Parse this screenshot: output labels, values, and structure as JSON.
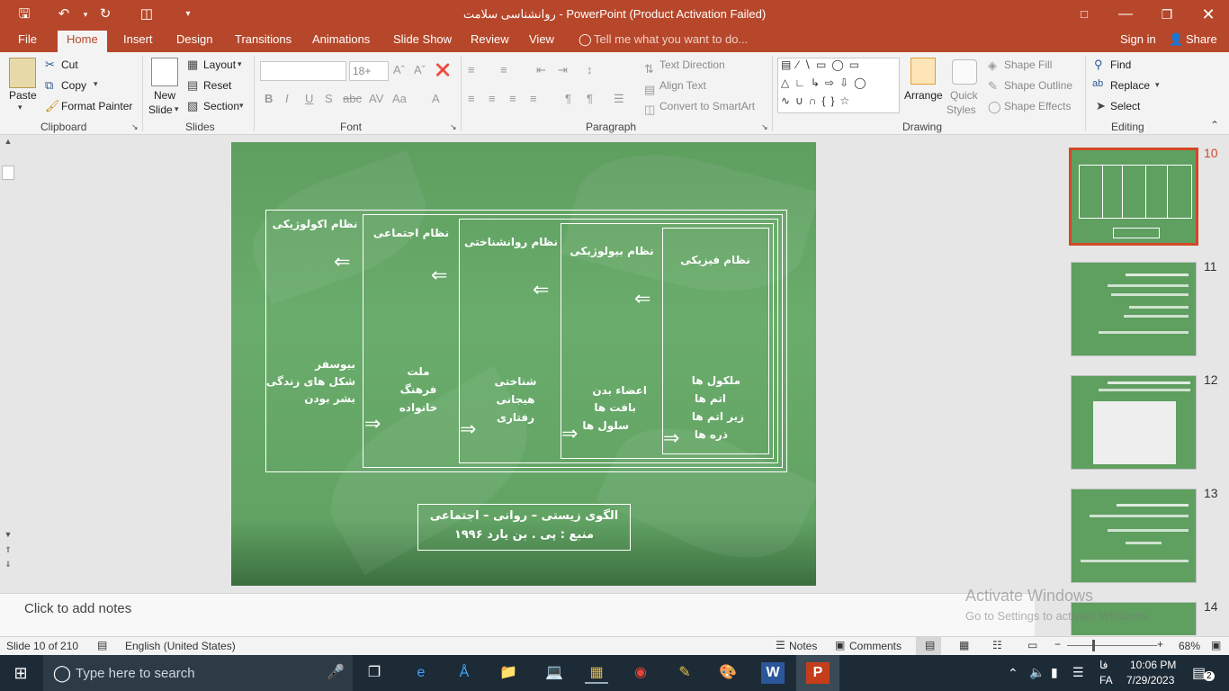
{
  "window": {
    "title": "روانشناسی سلامت - PowerPoint (Product Activation Failed)"
  },
  "tabs": [
    "File",
    "Home",
    "Insert",
    "Design",
    "Transitions",
    "Animations",
    "Slide Show",
    "Review",
    "View"
  ],
  "tell_me": "Tell me what you want to do...",
  "account": {
    "signin": "Sign in",
    "share": "Share"
  },
  "ribbon": {
    "clipboard": {
      "paste": "Paste",
      "cut": "Cut",
      "copy": "Copy",
      "format_painter": "Format Painter",
      "label": "Clipboard"
    },
    "slides": {
      "new_slide_1": "New",
      "new_slide_2": "Slide",
      "layout": "Layout",
      "reset": "Reset",
      "section": "Section",
      "label": "Slides"
    },
    "font": {
      "size": "18+",
      "label": "Font"
    },
    "paragraph": {
      "text_direction": "Text Direction",
      "align_text": "Align Text",
      "convert_smartart": "Convert to SmartArt",
      "label": "Paragraph"
    },
    "drawing": {
      "arrange": "Arrange",
      "quick_1": "Quick",
      "quick_2": "Styles",
      "shape_fill": "Shape Fill",
      "shape_outline": "Shape Outline",
      "shape_effects": "Shape Effects",
      "label": "Drawing"
    },
    "editing": {
      "find": "Find",
      "replace": "Replace",
      "select": "Select",
      "label": "Editing"
    }
  },
  "slide": {
    "systems": [
      "نظام اکولوژیکی",
      "نظام اجتماعی",
      "نظام روانشناختی",
      "نظام بیولوژیکی",
      "نظام فیزیکی"
    ],
    "eco_items": [
      "بیوسفر",
      "شکل های زندگی",
      "بشر بودن"
    ],
    "social_items": [
      "ملت",
      "فرهنگ",
      "خانواده"
    ],
    "psych_items": [
      "شناختی",
      "هیجانی",
      "رفتاری"
    ],
    "bio_items": [
      "اعضاء بدن",
      "بافت ها",
      "سلول ها"
    ],
    "phys_items": [
      "ملکول ها",
      "اتم ها",
      "زیر اتم ها",
      "ذره ها"
    ],
    "caption_1": "الگوی زیستی – روانی – اجتماعی",
    "caption_2": "منبع : پی . بن یارد ۱۹۹۶"
  },
  "thumbnails": [
    {
      "num": "10",
      "selected": true
    },
    {
      "num": "11"
    },
    {
      "num": "12"
    },
    {
      "num": "13"
    },
    {
      "num": "14"
    }
  ],
  "notes_placeholder": "Click to add notes",
  "watermark": {
    "line1": "Activate Windows",
    "line2": "Go to Settings to activate Windows."
  },
  "status": {
    "slide": "Slide 10 of 210",
    "language": "English (United States)",
    "notes": "Notes",
    "comments": "Comments",
    "zoom": "68%"
  },
  "taskbar": {
    "search": "Type here to search",
    "time": "10:06 PM",
    "date": "7/29/2023",
    "lang": "FA",
    "lang2": "فا",
    "notif": "2"
  }
}
